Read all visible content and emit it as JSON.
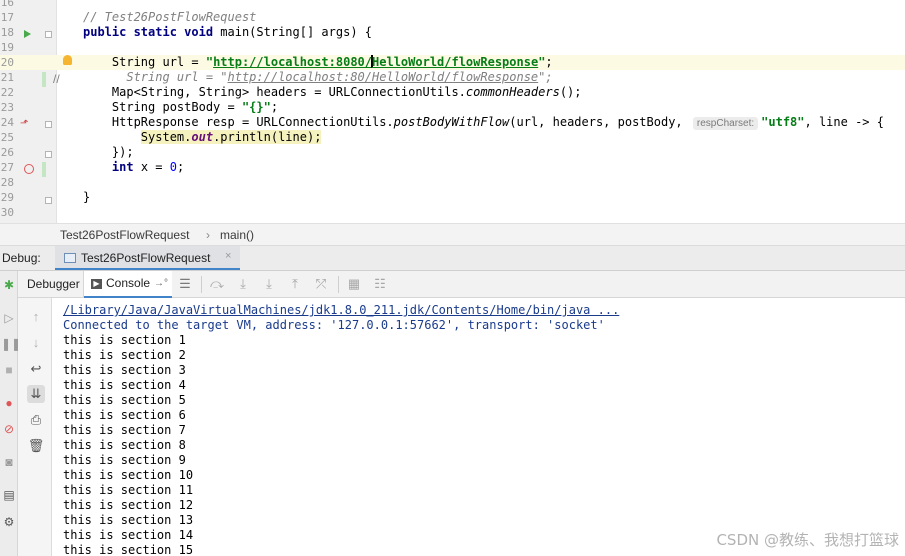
{
  "editor": {
    "lines": [
      {
        "n": "16",
        "html": ""
      },
      {
        "n": "17",
        "html": "<span class=\"cm\">// Test26PostFlowRequest</span>"
      },
      {
        "n": "18",
        "html": "<span class=\"kw\">public static void</span> main(String[] args) {"
      },
      {
        "n": "19",
        "html": ""
      },
      {
        "n": "20",
        "html": "    String url = <span class=\"str\">\"</span><span class=\"url\">http://localhost:8080/<span class=\"caret\"></span>HelloWorld/flowResponse</span><span class=\"str\">\"</span>;"
      },
      {
        "n": "21",
        "html": "<span class=\"cm\">      String url = \"</span><span class=\"curl\">http://localhost:80/HelloWorld/flowResponse</span><span class=\"cm\">\";</span>"
      },
      {
        "n": "22",
        "html": "    Map&lt;String, String&gt; headers = URLConnectionUtils.<span class=\"it\">commonHeaders</span>();"
      },
      {
        "n": "23",
        "html": "    String postBody = <span class=\"str\">\"{}\"</span>;"
      },
      {
        "n": "24",
        "html": "    HttpResponse resp = URLConnectionUtils.<span class=\"it\">postBodyWithFlow</span>(url, headers, postBody, <span class=\"hint\">respCharset:</span><span class=\"str\">\"utf8\"</span>, line -&gt; {"
      },
      {
        "n": "25",
        "html": "        <span class=\"sysout\">System.<span class=\"fld\">out</span>.println(line);</span>"
      },
      {
        "n": "26",
        "html": "    });"
      },
      {
        "n": "27",
        "html": "    <span class=\"kw\">int</span> x = <span class=\"num\">0</span>;"
      },
      {
        "n": "28",
        "html": ""
      },
      {
        "n": "29",
        "html": "}"
      },
      {
        "n": "30",
        "html": ""
      }
    ],
    "comment_marker": "//"
  },
  "breadcrumb": {
    "class_name": "Test26PostFlowRequest",
    "separator": "›",
    "method": "main()"
  },
  "debug": {
    "label": "Debug:",
    "session_tab": "Test26PostFlowRequest",
    "close": "×",
    "tabs": {
      "debugger": "Debugger",
      "console": "Console",
      "console_pin": "→°"
    }
  },
  "console": {
    "lines": [
      {
        "text": "/Library/Java/JavaVirtualMachines/jdk1.8.0_211.jdk/Contents/Home/bin/java ...",
        "style": "link"
      },
      {
        "text": "Connected to the target VM, address: '127.0.0.1:57662', transport: 'socket'",
        "style": "blue"
      },
      {
        "text": "this is section 1",
        "style": "norm"
      },
      {
        "text": "this is section 2",
        "style": "norm"
      },
      {
        "text": "this is section 3",
        "style": "norm"
      },
      {
        "text": "this is section 4",
        "style": "norm"
      },
      {
        "text": "this is section 5",
        "style": "norm"
      },
      {
        "text": "this is section 6",
        "style": "norm"
      },
      {
        "text": "this is section 7",
        "style": "norm"
      },
      {
        "text": "this is section 8",
        "style": "norm"
      },
      {
        "text": "this is section 9",
        "style": "norm"
      },
      {
        "text": "this is section 10",
        "style": "norm"
      },
      {
        "text": "this is section 11",
        "style": "norm"
      },
      {
        "text": "this is section 12",
        "style": "norm"
      },
      {
        "text": "this is section 13",
        "style": "norm"
      },
      {
        "text": "this is section 14",
        "style": "norm"
      },
      {
        "text": "this is section 15",
        "style": "norm"
      }
    ]
  },
  "watermark": "CSDN @教练、我想打篮球",
  "colors": {
    "accent": "#4083c9",
    "string": "#067d17",
    "keyword": "#000080"
  }
}
